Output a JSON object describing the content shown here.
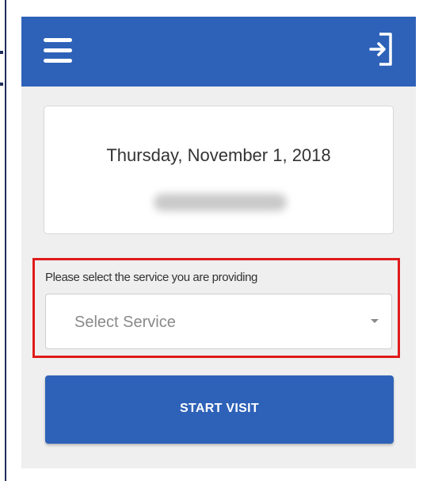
{
  "header": {
    "menu_icon": "hamburger-menu-icon",
    "logout_icon": "sign-out-arrow-icon",
    "background_color": "#2e62b8"
  },
  "date_card": {
    "date": "Thursday, November 1, 2018"
  },
  "service": {
    "label": "Please select the service you are providing",
    "placeholder": "Select Service",
    "highlight_color": "#e01b1b"
  },
  "actions": {
    "start_label": "START VISIT"
  }
}
